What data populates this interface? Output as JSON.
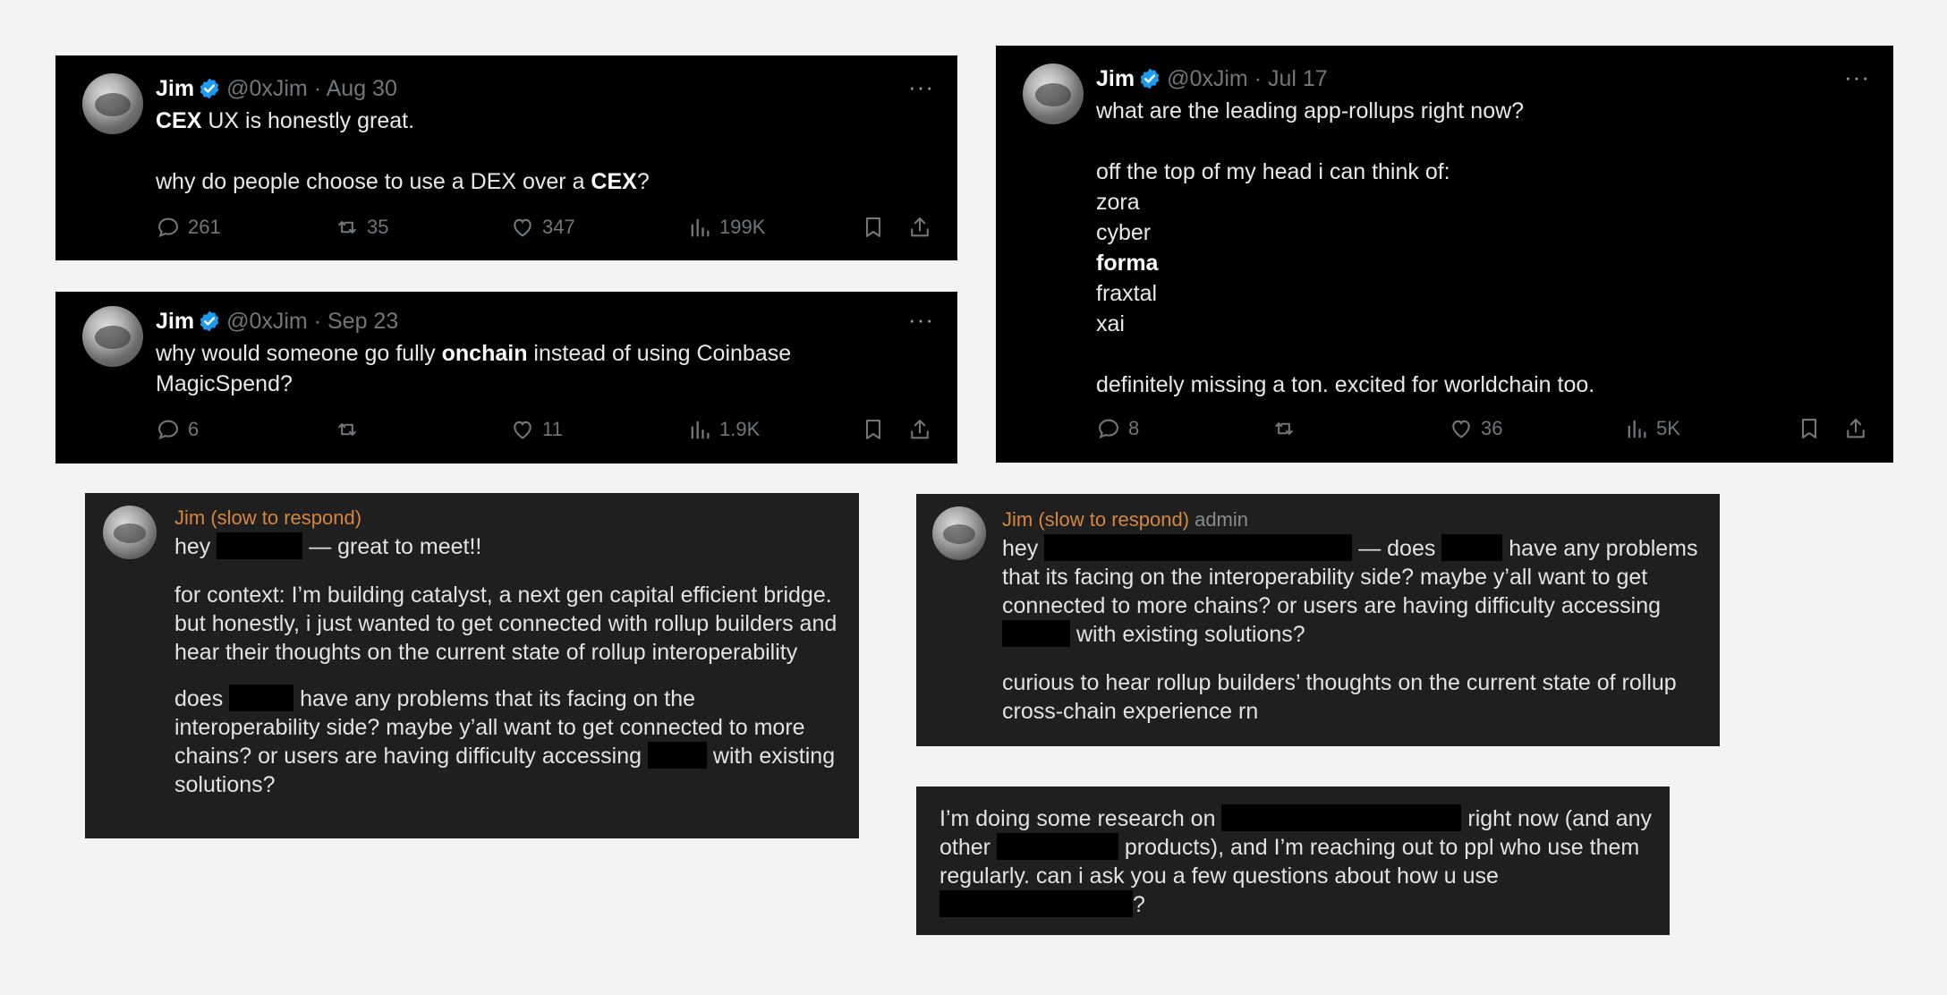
{
  "colors": {
    "page_bg": "#f3f3f3",
    "tweet_bg": "#000000",
    "chat_bg": "#1f1f1f",
    "verified_blue": "#1d9bf0",
    "chat_name": "#d4873e"
  },
  "tweets": [
    {
      "name": "Jim",
      "handle": "@0xJim",
      "date": "Aug 30",
      "dot": "·",
      "more": "···",
      "line1_bold": "CEX",
      "line1_rest": " UX is honestly great.",
      "line2_pre": "why do people choose to use a DEX over a ",
      "line2_bold": "CEX",
      "line2_post": "?",
      "replies": "261",
      "reposts": "35",
      "likes": "347",
      "views": "199K"
    },
    {
      "name": "Jim",
      "handle": "@0xJim",
      "date": "Sep 23",
      "dot": "·",
      "more": "···",
      "line1_pre": "why would someone go fully ",
      "line1_bold": "onchain",
      "line1_post": " instead of using Coinbase",
      "line2": "MagicSpend?",
      "replies": "6",
      "reposts": "",
      "likes": "11",
      "views": "1.9K"
    },
    {
      "name": "Jim",
      "handle": "@0xJim",
      "date": "Jul 17",
      "dot": "·",
      "more": "···",
      "line1": "what are the leading app-rollups right now?",
      "line2": "off the top of my head i can think of:",
      "list": [
        "zora",
        "cyber",
        "forma",
        "fraxtal",
        "xai"
      ],
      "line3": "definitely missing a ton. excited for worldchain too.",
      "replies": "8",
      "reposts": "",
      "likes": "36",
      "views": "5K"
    }
  ],
  "chats": [
    {
      "name": "Jim (slow to respond)",
      "p1_a": "hey ",
      "p1_b": " — great to meet!!",
      "p2": "for context: I’m building catalyst, a next gen capital efficient bridge. but honestly, i just wanted to get connected with rollup builders and hear their thoughts on the current state of rollup interoperability",
      "p3_a": "does ",
      "p3_b": " have any problems that its facing on the interoperability side? maybe y’all want to get connected to more chains? or users are having difficulty accessing ",
      "p3_c": " with existing solutions?"
    },
    {
      "name": "Jim (slow to respond)",
      "admin": "admin",
      "p1_a": "hey ",
      "p1_b": " — does ",
      "p1_c": " have any problems that its facing on the interoperability side? maybe y’all want to get connected to more chains? or users are having difficulty accessing ",
      "p1_d": " with existing solutions?",
      "p2": "curious to hear rollup builders’ thoughts on the current state of rollup cross-chain experience rn"
    },
    {
      "p1_a": "I’m doing some research on ",
      "p1_b": " right now (and any other ",
      "p1_c": " products), and I’m reaching out to ppl who use them regularly. can i ask you a few questions about how u use ",
      "p1_d": "?"
    }
  ]
}
